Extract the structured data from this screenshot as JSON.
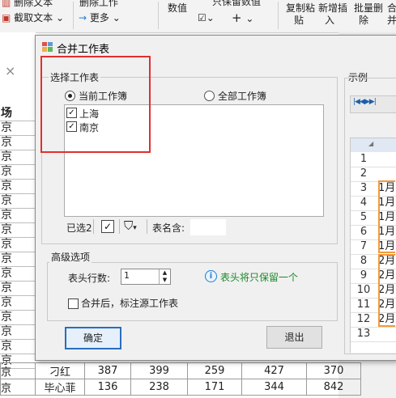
{
  "ribbon": {
    "delete_text": "删除文本",
    "cut_text": "截取文本",
    "arrow": "→",
    "more": "更多",
    "delete_sheet": "删除工作",
    "value": "数值",
    "keep_value": "只保留数值",
    "copy_paste_line1": "复制粘",
    "copy_paste_line2": "贴",
    "insert_line1": "新增插",
    "insert_line2": "入",
    "batch_delete_line1": "批量删",
    "batch_delete_line2": "除",
    "merge_line1": "合",
    "merge_line2": "并",
    "dropdown_arrow": "⌄",
    "plus": "+",
    "close_x": "×"
  },
  "sheet": {
    "left_header": "场",
    "left_cell": "京",
    "bottom_rows": [
      {
        "col0": "京",
        "name": "刁红",
        "v1": "387",
        "v2": "399",
        "v3": "259",
        "v4": "427",
        "v5": "370"
      },
      {
        "col0": "京",
        "name": "毕心菲",
        "v1": "136",
        "v2": "238",
        "v3": "171",
        "v4": "344",
        "v5": "842"
      }
    ]
  },
  "dialog": {
    "title": "合并工作表",
    "select_group": "选择工作表",
    "radio_current": "当前工作簿",
    "radio_all": "全部工作簿",
    "items": [
      {
        "label": "上海",
        "checked": true
      },
      {
        "label": "南京",
        "checked": true
      }
    ],
    "selected_count": "已选2",
    "sheet_name_label": "表名含:",
    "advanced_group": "高级选项",
    "header_rows_label": "表头行数:",
    "header_rows_value": "1",
    "header_hint": "表头将只保留一个",
    "annotate_label": "合并后，标注源工作表",
    "ok": "确定",
    "exit": "退出",
    "example_label": "示例"
  },
  "example": {
    "rows": [
      {
        "n": "1",
        "v": ""
      },
      {
        "n": "2",
        "v": ""
      },
      {
        "n": "3",
        "v": "1月"
      },
      {
        "n": "4",
        "v": "1月"
      },
      {
        "n": "5",
        "v": "1月"
      },
      {
        "n": "6",
        "v": "1月"
      },
      {
        "n": "7",
        "v": "1月"
      },
      {
        "n": "8",
        "v": "2月"
      },
      {
        "n": "9",
        "v": "2月"
      },
      {
        "n": "10",
        "v": "2月"
      },
      {
        "n": "11",
        "v": "2月"
      },
      {
        "n": "12",
        "v": "2月"
      },
      {
        "n": "13",
        "v": ""
      }
    ]
  },
  "colors": {
    "highlight_red": "#e0302f",
    "example_orange": "#f39a3b",
    "hint_green": "#1a8a2a",
    "info_blue": "#1d7fd6"
  }
}
